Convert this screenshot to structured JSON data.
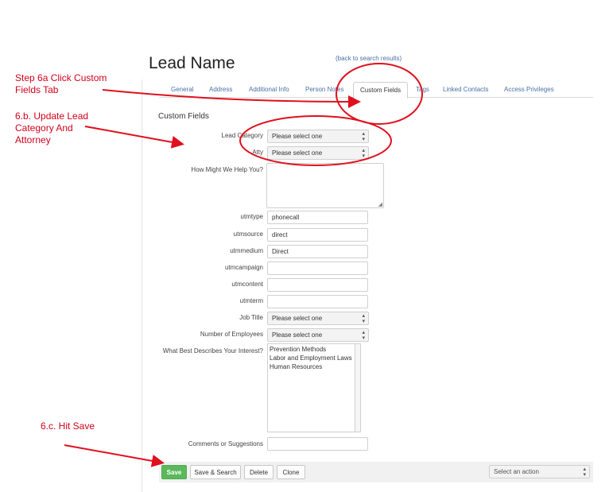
{
  "annotations": {
    "step_6a": "Step 6a  Click Custom Fields Tab",
    "step_6b": "6.b. Update Lead Category And Attorney",
    "step_6c": "6.c. Hit Save"
  },
  "header": {
    "title": "Lead Name",
    "back_link": "(back to search results)"
  },
  "tabs": [
    "General",
    "Address",
    "Additional Info",
    "Person Notes",
    "Custom Fields",
    "Tags",
    "Linked Contacts",
    "Access Privileges"
  ],
  "active_tab": "Custom Fields",
  "section_title": "Custom Fields",
  "fields": {
    "lead_category": {
      "label": "Lead Category",
      "value": "Please select one"
    },
    "atty": {
      "label": "Atty",
      "value": "Please select one"
    },
    "help": {
      "label": "How Might We Help You?",
      "value": ""
    },
    "utmtype": {
      "label": "utmtype",
      "value": "phonecall"
    },
    "utmsource": {
      "label": "utmsource",
      "value": "direct"
    },
    "utmmedium": {
      "label": "utmmedium",
      "value": "Direct"
    },
    "utmcampaign": {
      "label": "utmcampaign",
      "value": ""
    },
    "utmcontent": {
      "label": "utmcontent",
      "value": ""
    },
    "utmterm": {
      "label": "utmterm",
      "value": ""
    },
    "job_title": {
      "label": "Job Title",
      "value": "Please select one"
    },
    "num_employees": {
      "label": "Number of Employees",
      "value": "Please select one"
    },
    "interest": {
      "label": "What Best Describes Your Interest?",
      "options": [
        "Prevention Methods",
        "Labor and Employment Laws",
        "Human Resources"
      ]
    },
    "comments": {
      "label": "Comments or Suggestions",
      "value": ""
    }
  },
  "actions": {
    "save": "Save",
    "save_search": "Save & Search",
    "delete": "Delete",
    "clone": "Clone",
    "select_action": "Select an action"
  },
  "icons": {
    "select": "up-down-chevron-icon",
    "resize": "resize-grip-icon"
  },
  "colors": {
    "annotation": "#d0021b",
    "link": "#4a6fa5",
    "save_button": "#5cb85c"
  }
}
